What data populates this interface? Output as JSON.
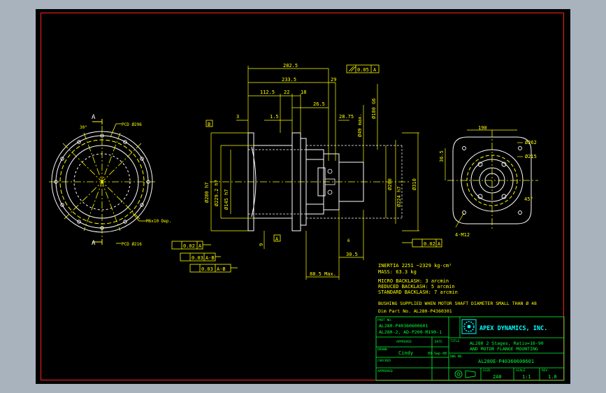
{
  "drawing": {
    "dims": {
      "overall_length": "282.5",
      "len_233": "233.5",
      "len_112": "112.5",
      "len_22": "22",
      "len_18": "18",
      "len_26": "26.5",
      "len_29": "29",
      "len_28": "28.75",
      "len_3": "3",
      "len_15": "1.5",
      "len_30_5": "30.5",
      "len_88": "88.5 Max.",
      "len_6": "6",
      "len_9": "9",
      "runout_flat": "0.05",
      "runout_flat_ref": "A",
      "par_a": "0.02",
      "par_a_ref": "A",
      "par_b": "0.02",
      "par_b_ref": "A",
      "perp1": "0.03",
      "perp1_ref": "A-B",
      "perp2": "0.03",
      "perp2_ref": "A-B",
      "datum_a": "A",
      "datum_b": "B",
      "pcd_top": "PCD Ø296",
      "pcd_bot": "PCD Ø216",
      "thread_left": "M6x10 Dep.",
      "angle_30": "30°",
      "sec_a1": "A",
      "sec_a2": "A",
      "dia_280": "Ø280 h7",
      "dia_229": "Ø229.2 h7",
      "dia_145": "Ø145 h7",
      "dia_3xx": "Ø200",
      "dia_224": "Ø224 h7",
      "dia_180": "Ø180 G6",
      "dia_49": "Ø49 max.",
      "dia_310": "Ø310",
      "dia_262": "Ø262",
      "dia_215": "Ø215",
      "dim_190": "190",
      "dim_36": "36.5",
      "angle_45": "45°",
      "thread_right": "4-M12"
    },
    "notes": {
      "inertia": "INERTIA   2251 ~2329 kg-cm²",
      "mass": "MASS: 63.3 kg",
      "micro": "MICRO BACKLASH: 3 arcmin",
      "reduced": "REDUCED BACKLASH: 5 arcmin",
      "standard": "STANDARD BACKLASH: 7 arcmin",
      "bushing": "BUSHING SUPPLIED WHEN MOTOR SHAFT DIAMETER SMALL THAN Ø 48",
      "dim_part": "Dim Part No. AL280-P4360301"
    },
    "title_block": {
      "part_no_label": "PART NO.",
      "part_no_1": "AL280-P40360600601",
      "part_no_2": "AL280-2, AD-P200-M190-1",
      "approved_label": "APPROVED",
      "date_label": "DATE",
      "drawn_label": "DRAWN",
      "drawn_by": "Cindy",
      "drawn_date": "09-Sep-08",
      "checked_label": "CHECKED",
      "approved2_label": "APPROVED",
      "company": "APEX DYNAMICS, INC.",
      "title_label": "TITLE",
      "title_1": "AL280 2 Stages, Ratio=16-90",
      "title_2": "AND MOTOR FLANGE MOUNTING",
      "dwg_label": "DWG NO.",
      "dwg_no": "AL280E-P40360600601",
      "size_label": "SIZE",
      "size": "2A0",
      "scale_label": "SCALE",
      "scale": "1:1",
      "rev_label": "REV.",
      "rev": "1.0"
    }
  },
  "colors": {
    "background": "#000000",
    "dimension": "#ffff00",
    "geometry": "#ffffff",
    "titleblock": "#00ff33",
    "logo": "#00ffff",
    "border": "#ff2020"
  }
}
